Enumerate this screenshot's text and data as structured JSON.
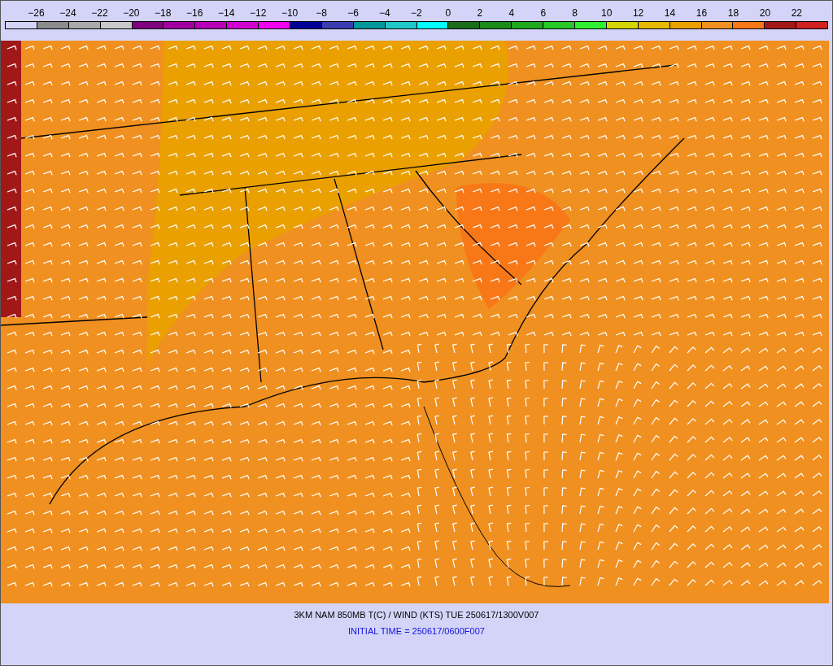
{
  "legend": {
    "labels": [
      "−26",
      "−24",
      "−22",
      "−20",
      "−18",
      "−16",
      "−14",
      "−12",
      "−10",
      "−8",
      "−6",
      "−4",
      "−2",
      "0",
      "2",
      "4",
      "6",
      "8",
      "10",
      "12",
      "14",
      "16",
      "18",
      "20",
      "22"
    ],
    "swatches": [
      {
        "color": "#d4d4f8"
      },
      {
        "color": "#8c8c8c"
      },
      {
        "color": "#aaaaaa"
      },
      {
        "color": "#c8c8c8"
      },
      {
        "color": "#800080"
      },
      {
        "color": "#a000a0"
      },
      {
        "color": "#b800b8"
      },
      {
        "color": "#d000d0"
      },
      {
        "color": "#f000f0"
      },
      {
        "color": "#000099"
      },
      {
        "color": "#3c3cb0"
      },
      {
        "color": "#009999"
      },
      {
        "color": "#1ec8c8"
      },
      {
        "color": "#00ffff"
      },
      {
        "color": "#1a6e1a"
      },
      {
        "color": "#1a8c1a"
      },
      {
        "color": "#20a820"
      },
      {
        "color": "#28c828"
      },
      {
        "color": "#30f030"
      },
      {
        "color": "#d4d400"
      },
      {
        "color": "#e6b800"
      },
      {
        "color": "#eaa000"
      },
      {
        "color": "#f09020"
      },
      {
        "color": "#f87818"
      },
      {
        "color": "#a01818"
      },
      {
        "color": "#d02020"
      }
    ]
  },
  "caption": {
    "title": "3KM NAM 850MB T(C) / WIND (KTS) TUE 250617/1300V007",
    "initial_time": "INITIAL TIME = 250617/0600F007"
  }
}
